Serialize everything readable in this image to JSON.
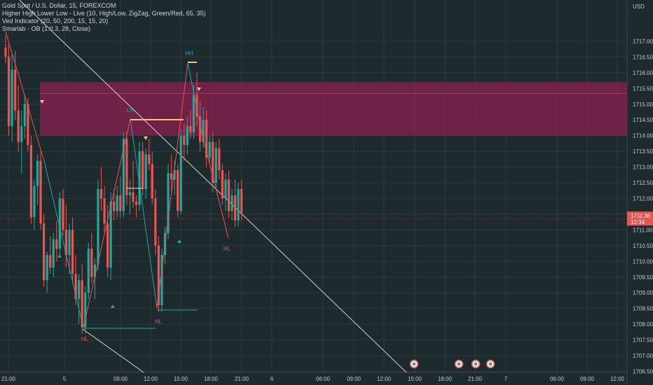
{
  "legend": {
    "line1": "Gold Spot / U.S. Dollar, 15, FOREXCOM",
    "line2": "Higher High Lower Low - Live (10, High/Low, ZigZag, Green/Red, 65, 35)",
    "line3": "Ved Indicator (20, 50, 200, 15, 15, 20)",
    "line4": "Smarlab - OB (1.0.3, 28, Close)"
  },
  "price_axis": {
    "currency": "USD",
    "current_price": "1711.36",
    "current_sub": "12:34"
  },
  "colors": {
    "background": "#1e2b2e",
    "grid": "#2c3a3d",
    "up": "#26a69a",
    "down": "#ef5350",
    "zone_fill": "#8c1f4f",
    "level_line": "#f7c774",
    "trend_line": "#cfd3d6",
    "zigzag": "#d9d9d9"
  },
  "chart_data": {
    "type": "candlestick",
    "symbol": "Gold Spot / U.S. Dollar",
    "timeframe": "15",
    "ylim": [
      1706.5,
      1717.5
    ],
    "y_ticks": [
      "1717.00",
      "1716.50",
      "1716.00",
      "1715.50",
      "1715.00",
      "1714.50",
      "1714.00",
      "1713.50",
      "1713.00",
      "1712.50",
      "1712.00",
      "1711.50",
      "1711.00",
      "1710.50",
      "1710.00",
      "1709.50",
      "1709.00",
      "1708.50",
      "1708.00",
      "1707.50",
      "1707.00",
      "1706.50"
    ],
    "x_ticks": [
      "21:00",
      "5",
      "09:00",
      "12:00",
      "15:00",
      "18:00",
      "21:00",
      "6",
      "06:00",
      "09:00",
      "12:00",
      "15:00",
      "18:00",
      "21:00",
      "7",
      "06:00",
      "09:00",
      "12:00"
    ],
    "order_block_zone": [
      1714.0,
      1715.7
    ],
    "swing_labels": [
      {
        "text": "HH",
        "price": 1716.3
      },
      {
        "text": "LH",
        "price": 1714.6
      },
      {
        "text": "HL",
        "price": 1707.7
      },
      {
        "text": "HL",
        "price": 1708.1
      },
      {
        "text": "HL",
        "price": 1710.3
      }
    ],
    "candles": [
      [
        1716.8,
        1717.2,
        1716.3,
        1716.5
      ],
      [
        1716.5,
        1716.9,
        1714.0,
        1714.3
      ],
      [
        1714.3,
        1716.6,
        1713.8,
        1716.1
      ],
      [
        1716.1,
        1716.7,
        1714.5,
        1714.8
      ],
      [
        1714.8,
        1715.6,
        1713.5,
        1713.8
      ],
      [
        1713.8,
        1714.8,
        1712.8,
        1714.3
      ],
      [
        1714.3,
        1715.3,
        1713.9,
        1715.0
      ],
      [
        1715.0,
        1715.2,
        1713.5,
        1713.7
      ],
      [
        1713.7,
        1714.0,
        1711.2,
        1711.4
      ],
      [
        1711.4,
        1712.6,
        1711.0,
        1712.4
      ],
      [
        1712.4,
        1713.4,
        1711.8,
        1713.2
      ],
      [
        1713.2,
        1713.5,
        1711.0,
        1711.2
      ],
      [
        1711.2,
        1711.5,
        1709.2,
        1709.4
      ],
      [
        1709.4,
        1710.3,
        1709.0,
        1710.2
      ],
      [
        1710.2,
        1710.8,
        1709.6,
        1709.8
      ],
      [
        1709.8,
        1710.9,
        1709.5,
        1710.7
      ],
      [
        1710.7,
        1711.3,
        1710.0,
        1710.4
      ],
      [
        1710.4,
        1712.2,
        1710.2,
        1712.0
      ],
      [
        1712.0,
        1712.3,
        1710.8,
        1711.0
      ],
      [
        1711.0,
        1711.8,
        1709.8,
        1710.2
      ],
      [
        1710.2,
        1711.2,
        1709.6,
        1711.0
      ],
      [
        1711.0,
        1711.4,
        1709.3,
        1709.6
      ],
      [
        1709.6,
        1710.2,
        1708.6,
        1708.8
      ],
      [
        1708.8,
        1709.6,
        1708.0,
        1709.4
      ],
      [
        1709.4,
        1709.9,
        1707.7,
        1707.9
      ],
      [
        1707.9,
        1709.2,
        1707.7,
        1709.0
      ],
      [
        1709.0,
        1710.6,
        1708.8,
        1710.4
      ],
      [
        1710.4,
        1710.9,
        1709.3,
        1709.5
      ],
      [
        1709.5,
        1710.1,
        1708.8,
        1709.9
      ],
      [
        1709.9,
        1712.6,
        1709.7,
        1712.3
      ],
      [
        1712.3,
        1713.0,
        1711.6,
        1712.0
      ],
      [
        1712.0,
        1712.4,
        1710.9,
        1711.2
      ],
      [
        1711.2,
        1711.8,
        1709.5,
        1709.8
      ],
      [
        1709.8,
        1712.2,
        1709.4,
        1711.9
      ],
      [
        1711.9,
        1712.3,
        1711.3,
        1711.6
      ],
      [
        1711.6,
        1712.4,
        1711.4,
        1712.1
      ],
      [
        1712.1,
        1712.7,
        1711.4,
        1711.6
      ],
      [
        1711.6,
        1714.1,
        1711.4,
        1713.9
      ],
      [
        1713.9,
        1714.1,
        1711.8,
        1712.1
      ],
      [
        1712.1,
        1712.6,
        1711.5,
        1712.2
      ],
      [
        1712.2,
        1713.2,
        1711.7,
        1711.9
      ],
      [
        1711.9,
        1712.1,
        1711.4,
        1711.8
      ],
      [
        1711.8,
        1713.8,
        1711.6,
        1713.5
      ],
      [
        1713.5,
        1713.8,
        1712.1,
        1712.3
      ],
      [
        1712.3,
        1713.6,
        1712.0,
        1713.4
      ],
      [
        1713.4,
        1713.9,
        1712.9,
        1713.1
      ],
      [
        1713.1,
        1713.5,
        1711.8,
        1712.0
      ],
      [
        1712.0,
        1712.3,
        1710.2,
        1710.5
      ],
      [
        1710.5,
        1710.8,
        1708.4,
        1708.6
      ],
      [
        1708.6,
        1710.4,
        1708.4,
        1710.2
      ],
      [
        1710.2,
        1711.1,
        1709.9,
        1710.9
      ],
      [
        1710.9,
        1713.1,
        1710.7,
        1712.8
      ],
      [
        1712.8,
        1713.4,
        1712.2,
        1712.6
      ],
      [
        1712.6,
        1713.2,
        1712.1,
        1712.9
      ],
      [
        1712.9,
        1713.1,
        1711.4,
        1711.6
      ],
      [
        1711.6,
        1714.2,
        1711.5,
        1714.0
      ],
      [
        1714.0,
        1714.4,
        1713.2,
        1713.7
      ],
      [
        1713.7,
        1714.6,
        1713.4,
        1714.3
      ],
      [
        1714.3,
        1714.8,
        1713.9,
        1714.1
      ],
      [
        1714.1,
        1715.6,
        1713.9,
        1715.3
      ],
      [
        1715.3,
        1716.0,
        1714.3,
        1714.6
      ],
      [
        1714.6,
        1715.1,
        1713.5,
        1713.8
      ],
      [
        1713.8,
        1714.9,
        1713.6,
        1714.5
      ],
      [
        1714.5,
        1714.8,
        1713.0,
        1713.3
      ],
      [
        1713.3,
        1714.0,
        1713.1,
        1713.8
      ],
      [
        1713.8,
        1714.1,
        1712.2,
        1712.5
      ],
      [
        1712.5,
        1713.8,
        1712.3,
        1713.6
      ],
      [
        1713.6,
        1713.9,
        1712.6,
        1712.9
      ],
      [
        1712.9,
        1713.1,
        1711.8,
        1712.0
      ],
      [
        1712.0,
        1712.8,
        1711.6,
        1712.6
      ],
      [
        1712.6,
        1712.9,
        1711.4,
        1711.6
      ],
      [
        1711.6,
        1712.3,
        1711.3,
        1712.1
      ],
      [
        1712.1,
        1712.6,
        1711.1,
        1711.3
      ],
      [
        1711.3,
        1712.5,
        1711.1,
        1712.3
      ],
      [
        1712.3,
        1712.6,
        1711.3,
        1711.5
      ]
    ]
  }
}
